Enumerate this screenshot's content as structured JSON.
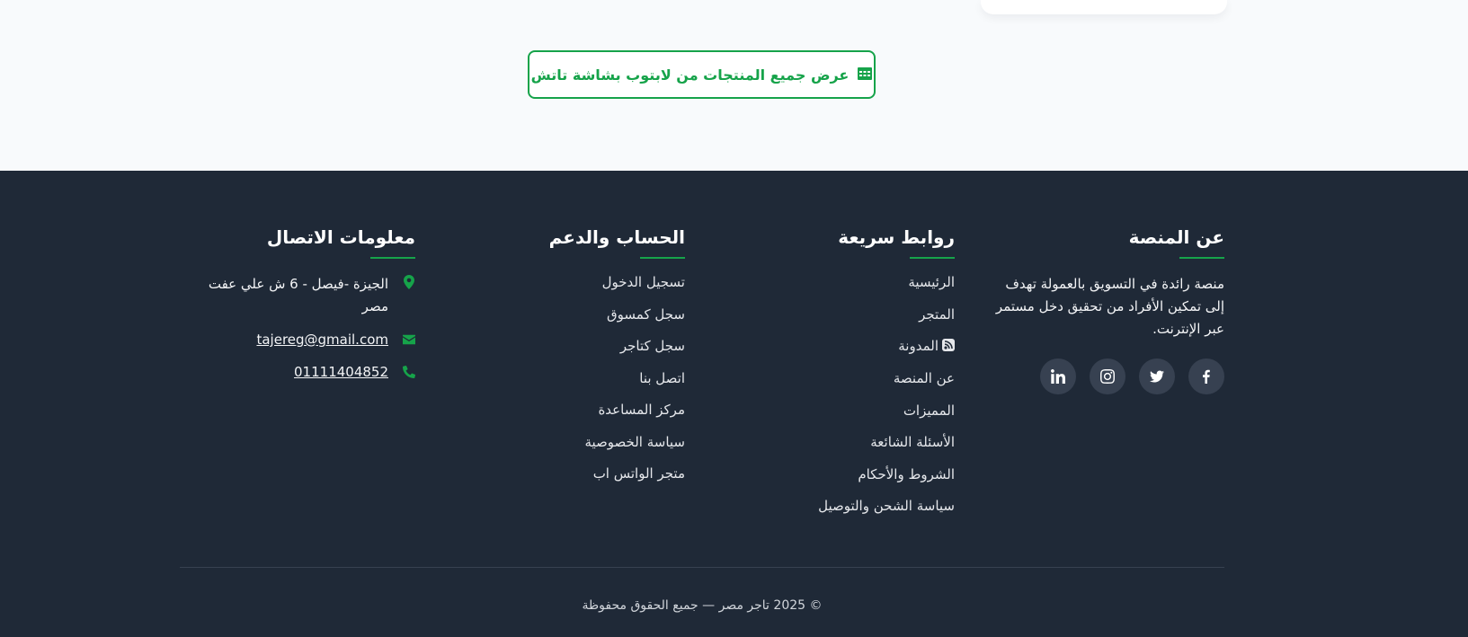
{
  "main": {
    "view_all_label": "عرض جميع المنتجات من لابتوب بشاشة تاتش"
  },
  "footer": {
    "about": {
      "title": "عن المنصة",
      "text": "منصة رائدة في التسويق بالعمولة تهدف إلى تمكين الأفراد من تحقيق دخل مستمر عبر الإنترنت.",
      "socials": [
        "facebook-icon",
        "twitter-icon",
        "instagram-icon",
        "linkedin-icon"
      ]
    },
    "quick_links": {
      "title": "روابط سريعة",
      "items": [
        "الرئيسية",
        "المتجر",
        "المدونة",
        "عن المنصة",
        "المميزات",
        "الأسئلة الشائعة",
        "الشروط والأحكام",
        "سياسة الشحن والتوصيل"
      ]
    },
    "account": {
      "title": "الحساب والدعم",
      "items": [
        "تسجيل الدخول",
        "سجل كمسوق",
        "سجل كتاجر",
        "اتصل بنا",
        "مركز المساعدة",
        "سياسة الخصوصية",
        "متجر الواتس اب"
      ]
    },
    "contact": {
      "title": "معلومات الاتصال",
      "address": "الجيزة -فيصل - 6 ش علي عفت مصر",
      "email": "tajereg@gmail.com",
      "phone": "01111404852"
    },
    "copyright": "© 2025 تاجر مصر — جميع الحقوق محفوظة"
  },
  "colors": {
    "accent": "#16a34a",
    "footer_bg": "#1f2937",
    "page_bg": "#f8fafc"
  }
}
